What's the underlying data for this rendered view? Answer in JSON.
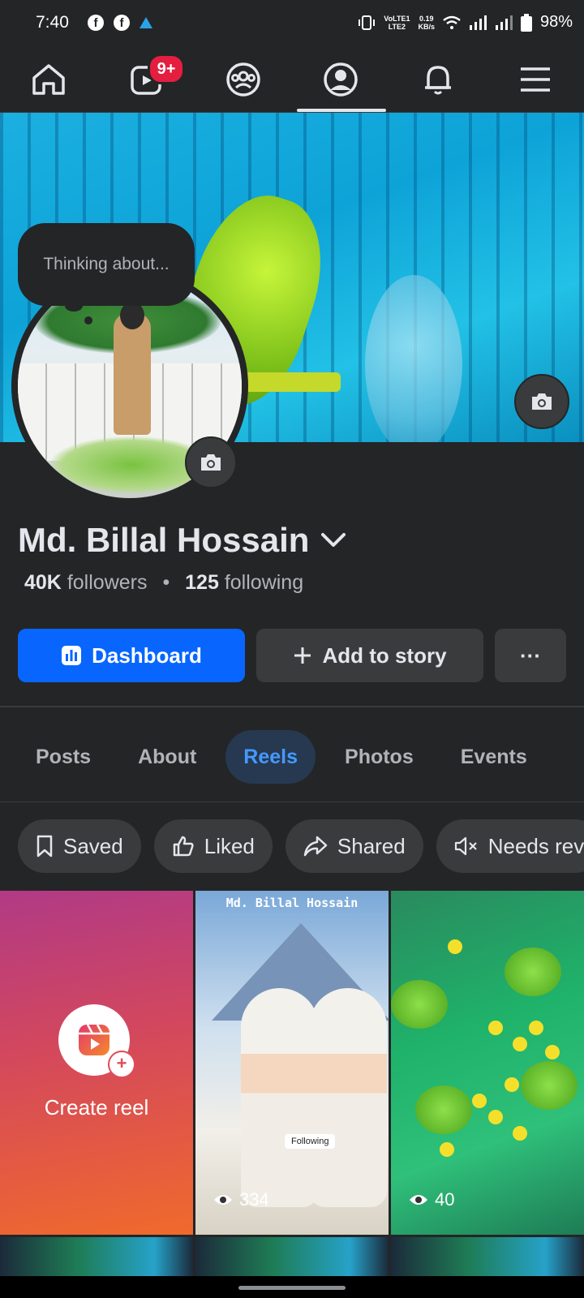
{
  "status_bar": {
    "time": "7:40",
    "signal_text_top": "VoLTE1",
    "signal_text_bottom": "LTE2",
    "speed_top": "0.19",
    "speed_bottom": "KB/s",
    "battery": "98%"
  },
  "nav": {
    "items": [
      "home-icon",
      "video-icon",
      "groups-icon",
      "profile-icon",
      "notifications-icon",
      "menu-icon"
    ],
    "video_badge": "9+",
    "active": "profile-icon"
  },
  "profile": {
    "thought_bubble": "Thinking about...",
    "name": "Md. Billal Hossain",
    "followers_count": "40K",
    "followers_label": "followers",
    "separator": "•",
    "following_count": "125",
    "following_label": "following"
  },
  "actions": {
    "dashboard": "Dashboard",
    "add_story": "Add to story",
    "more": "···"
  },
  "tabs": [
    "Posts",
    "About",
    "Reels",
    "Photos",
    "Events"
  ],
  "active_tab": "Reels",
  "filters": [
    "Saved",
    "Liked",
    "Shared",
    "Needs rev"
  ],
  "reels": {
    "create_label": "Create reel",
    "items": [
      {
        "title": "Md. Billal Hossain",
        "overlay": "Following",
        "views": "334"
      },
      {
        "views": "40"
      }
    ]
  },
  "colors": {
    "background": "#242526",
    "primary": "#0866ff",
    "badge": "#e41e3f",
    "active_tab_bg": "#263951",
    "active_tab_text": "#4599ff"
  }
}
